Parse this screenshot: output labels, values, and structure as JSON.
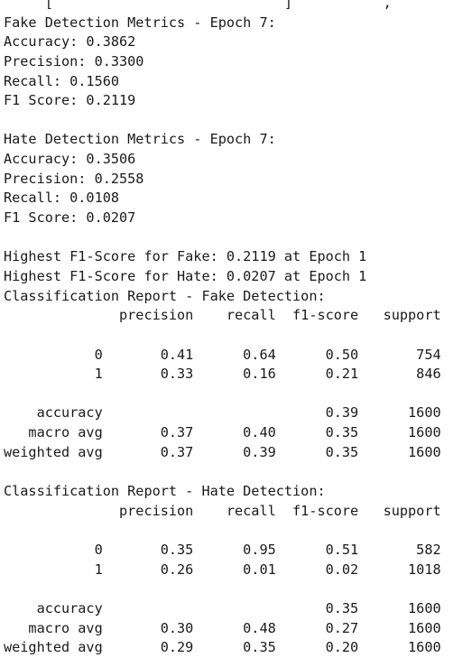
{
  "output": {
    "clipped_top_line": "Fake Detection Metrics - Epoch 7: ... ... , ...",
    "lines": [
      "Fake Detection Metrics - Epoch 7:",
      "Accuracy: 0.3862",
      "Precision: 0.3300",
      "Recall: 0.1560",
      "F1 Score: 0.2119",
      "",
      "Hate Detection Metrics - Epoch 7:",
      "Accuracy: 0.3506",
      "Precision: 0.2558",
      "Recall: 0.0108",
      "F1 Score: 0.0207",
      "",
      "Highest F1-Score for Fake: 0.2119 at Epoch 1",
      "Highest F1-Score for Hate: 0.0207 at Epoch 1",
      "Classification Report - Fake Detection:",
      "              precision    recall  f1-score   support",
      "",
      "           0       0.41      0.64      0.50       754",
      "           1       0.33      0.16      0.21       846",
      "",
      "    accuracy                           0.39      1600",
      "   macro avg       0.37      0.40      0.35      1600",
      "weighted avg       0.37      0.39      0.35      1600",
      "",
      "Classification Report - Hate Detection:",
      "              precision    recall  f1-score   support",
      "",
      "           0       0.35      0.95      0.51       582",
      "           1       0.26      0.01      0.02      1018",
      "",
      "    accuracy                           0.35      1600",
      "   macro avg       0.30      0.48      0.27      1600",
      "weighted avg       0.29      0.35      0.20      1600"
    ]
  }
}
